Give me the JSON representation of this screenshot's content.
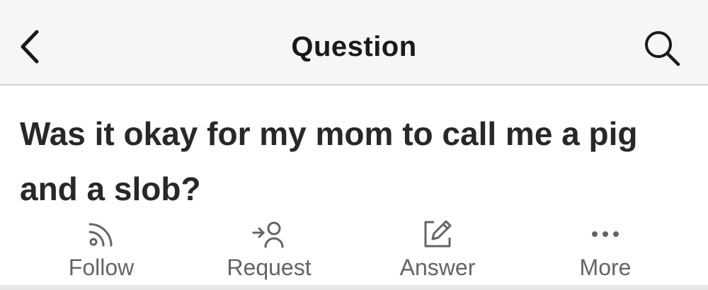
{
  "header": {
    "title": "Question",
    "back_icon": "chevron-left-icon",
    "search_icon": "search-icon"
  },
  "question": {
    "title": "Was it okay for my mom to call me a pig and a slob?"
  },
  "actions": [
    {
      "label": "Follow",
      "icon": "follow-rss-icon"
    },
    {
      "label": "Request",
      "icon": "request-user-icon"
    },
    {
      "label": "Answer",
      "icon": "answer-pencil-icon"
    },
    {
      "label": "More",
      "icon": "more-dots-icon"
    }
  ],
  "colors": {
    "header_bg": "#f6f6f6",
    "title_text": "#282829",
    "action_text": "#636466",
    "icon": "#636466",
    "divider": "#d4d4d4"
  }
}
